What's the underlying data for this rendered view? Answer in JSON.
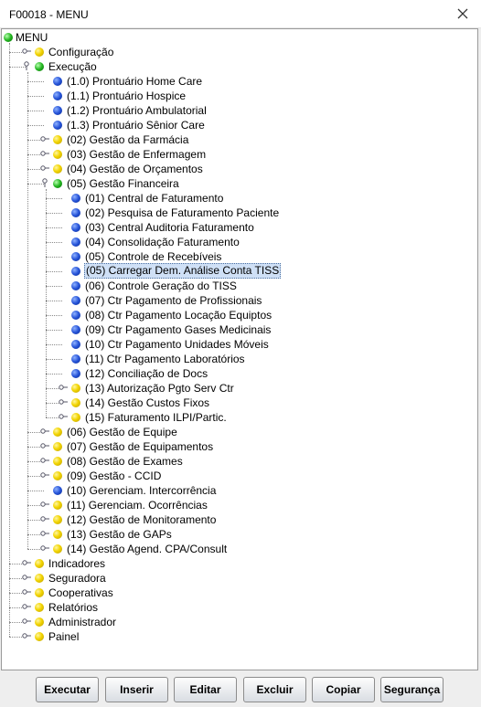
{
  "window": {
    "title": "F00018 - MENU",
    "close_icon": "close-icon"
  },
  "colors": {
    "yellow": "#f2d400",
    "blue": "#2553d8",
    "green": "#22b51f",
    "selection": "#cfe0f6"
  },
  "tree": [
    {
      "label": "MENU",
      "color": "green",
      "depth": 0,
      "state": "expanded",
      "root": true
    },
    {
      "label": "Configuração",
      "color": "yellow",
      "depth": 1,
      "state": "collapsed"
    },
    {
      "label": "Execução",
      "color": "green",
      "depth": 1,
      "state": "expanded"
    },
    {
      "label": "(1.0) Prontuário Home Care",
      "color": "blue",
      "depth": 2,
      "state": "leaf"
    },
    {
      "label": "(1.1) Prontuário Hospice",
      "color": "blue",
      "depth": 2,
      "state": "leaf"
    },
    {
      "label": "(1.2) Prontuário Ambulatorial",
      "color": "blue",
      "depth": 2,
      "state": "leaf"
    },
    {
      "label": "(1.3) Prontuário Sênior Care",
      "color": "blue",
      "depth": 2,
      "state": "leaf"
    },
    {
      "label": "(02) Gestão da Farmácia",
      "color": "yellow",
      "depth": 2,
      "state": "collapsed"
    },
    {
      "label": "(03) Gestão de Enfermagem",
      "color": "yellow",
      "depth": 2,
      "state": "collapsed"
    },
    {
      "label": "(04) Gestão de Orçamentos",
      "color": "yellow",
      "depth": 2,
      "state": "collapsed"
    },
    {
      "label": "(05) Gestão Financeira",
      "color": "green",
      "depth": 2,
      "state": "expanded"
    },
    {
      "label": "(01) Central de Faturamento",
      "color": "blue",
      "depth": 3,
      "state": "leaf"
    },
    {
      "label": "(02) Pesquisa de Faturamento Paciente",
      "color": "blue",
      "depth": 3,
      "state": "leaf"
    },
    {
      "label": "(03) Central Auditoria Faturamento",
      "color": "blue",
      "depth": 3,
      "state": "leaf"
    },
    {
      "label": "(04) Consolidação Faturamento",
      "color": "blue",
      "depth": 3,
      "state": "leaf"
    },
    {
      "label": "(05) Controle de Recebíveis",
      "color": "blue",
      "depth": 3,
      "state": "leaf"
    },
    {
      "label": "(05) Carregar Dem. Análise Conta TISS",
      "color": "blue",
      "depth": 3,
      "state": "leaf",
      "selected": true
    },
    {
      "label": "(06) Controle Geração  do TISS",
      "color": "blue",
      "depth": 3,
      "state": "leaf"
    },
    {
      "label": "(07) Ctr Pagamento de Profissionais",
      "color": "blue",
      "depth": 3,
      "state": "leaf"
    },
    {
      "label": "(08) Ctr Pagamento Locação Equiptos",
      "color": "blue",
      "depth": 3,
      "state": "leaf"
    },
    {
      "label": "(09) Ctr Pagamento Gases Medicinais",
      "color": "blue",
      "depth": 3,
      "state": "leaf"
    },
    {
      "label": "(10) Ctr Pagamento Unidades Móveis",
      "color": "blue",
      "depth": 3,
      "state": "leaf"
    },
    {
      "label": "(11) Ctr Pagamento Laboratórios",
      "color": "blue",
      "depth": 3,
      "state": "leaf"
    },
    {
      "label": "(12) Conciliação de Docs",
      "color": "blue",
      "depth": 3,
      "state": "leaf"
    },
    {
      "label": "(13) Autorização Pgto Serv Ctr",
      "color": "yellow",
      "depth": 3,
      "state": "collapsed"
    },
    {
      "label": "(14) Gestão Custos Fixos",
      "color": "yellow",
      "depth": 3,
      "state": "collapsed"
    },
    {
      "label": "(15) Faturamento ILPI/Partic.",
      "color": "yellow",
      "depth": 3,
      "state": "collapsed"
    },
    {
      "label": "(06) Gestão de Equipe",
      "color": "yellow",
      "depth": 2,
      "state": "collapsed"
    },
    {
      "label": "(07) Gestão de Equipamentos",
      "color": "yellow",
      "depth": 2,
      "state": "collapsed"
    },
    {
      "label": "(08) Gestão de Exames",
      "color": "yellow",
      "depth": 2,
      "state": "collapsed"
    },
    {
      "label": "(09) Gestão - CCID",
      "color": "yellow",
      "depth": 2,
      "state": "collapsed"
    },
    {
      "label": "(10) Gerenciam. Intercorrência",
      "color": "blue",
      "depth": 2,
      "state": "leaf"
    },
    {
      "label": "(11) Gerenciam. Ocorrências",
      "color": "yellow",
      "depth": 2,
      "state": "collapsed"
    },
    {
      "label": "(12) Gestão de Monitoramento",
      "color": "yellow",
      "depth": 2,
      "state": "collapsed"
    },
    {
      "label": "(13) Gestão de GAPs",
      "color": "yellow",
      "depth": 2,
      "state": "collapsed"
    },
    {
      "label": "(14) Gestão Agend. CPA/Consult",
      "color": "yellow",
      "depth": 2,
      "state": "collapsed"
    },
    {
      "label": "Indicadores",
      "color": "yellow",
      "depth": 1,
      "state": "collapsed"
    },
    {
      "label": "Seguradora",
      "color": "yellow",
      "depth": 1,
      "state": "collapsed"
    },
    {
      "label": "Cooperativas",
      "color": "yellow",
      "depth": 1,
      "state": "collapsed"
    },
    {
      "label": "Relatórios",
      "color": "yellow",
      "depth": 1,
      "state": "collapsed"
    },
    {
      "label": "Administrador",
      "color": "yellow",
      "depth": 1,
      "state": "collapsed"
    },
    {
      "label": "Painel",
      "color": "yellow",
      "depth": 1,
      "state": "collapsed"
    }
  ],
  "buttons": [
    {
      "name": "executar-button",
      "label": "Executar"
    },
    {
      "name": "inserir-button",
      "label": "Inserir"
    },
    {
      "name": "editar-button",
      "label": "Editar"
    },
    {
      "name": "excluir-button",
      "label": "Excluir"
    },
    {
      "name": "copiar-button",
      "label": "Copiar"
    },
    {
      "name": "seguranca-button",
      "label": "Segurança"
    }
  ]
}
